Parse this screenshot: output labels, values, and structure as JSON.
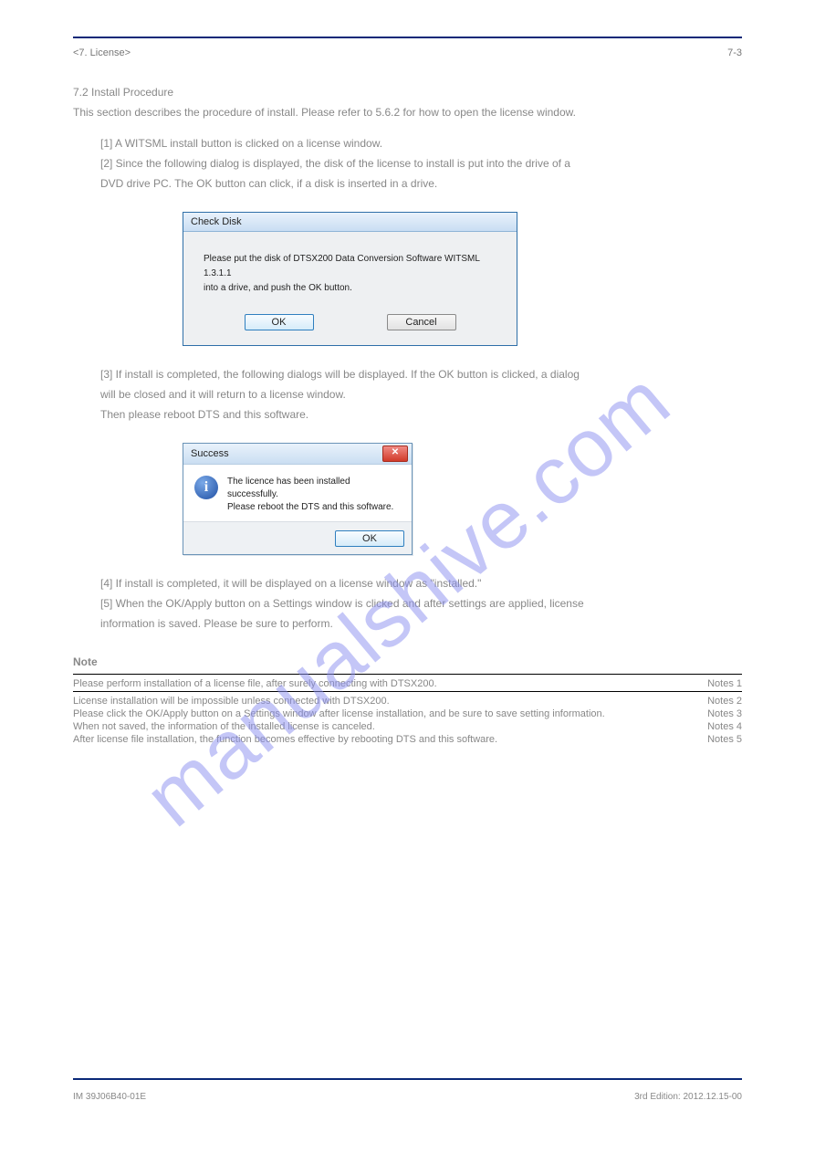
{
  "header": {
    "doc_ref": "<7. License>",
    "page_num": "7-3"
  },
  "intro": {
    "line1": "7.2  Install Procedure",
    "line2": "This section describes the procedure of install. Please refer to 5.6.2 for how to open the license window.",
    "step1": "[1] A WITSML install button is clicked on a license window.",
    "step2_a": "[2] Since the following dialog is displayed, the disk of the license to install is put into the drive of a",
    "step2_b": "DVD drive PC. The OK button can click, if a disk is inserted in a drive."
  },
  "dlg1": {
    "title": "Check Disk",
    "msg1": "Please put the disk of DTSX200 Data Conversion Software WITSML 1.3.1.1",
    "msg2": "into a drive, and push the OK button.",
    "ok": "OK",
    "cancel": "Cancel"
  },
  "between": {
    "step3_a": "[3] If install is completed, the following dialogs will be displayed. If the OK button is clicked, a dialog",
    "step3_b": "will be closed and it will return to a license window.",
    "step3_c": "Then please reboot DTS and this software."
  },
  "dlg2": {
    "title": "Success",
    "msg1": "The licence has been installed successfully.",
    "msg2": "Please reboot the DTS and this software.",
    "ok": "OK"
  },
  "after": {
    "step4": "[4] If install is completed, it will be displayed on a license window as \"installed.\"",
    "step5_a": "[5] When the OK/Apply button on a Settings window is clicked and after settings are applied, license",
    "step5_b": "information is saved. Please be sure to perform."
  },
  "notes": {
    "heading": "Note",
    "n1_left": "Please perform installation of a license file, after surely connecting with DTSX200.",
    "n1_right": "Notes 1",
    "n2_left": "License installation will be impossible unless connected with DTSX200.",
    "n2_right": "Notes 2",
    "n3_left": "Please click the OK/Apply button on a Settings window after license installation, and be sure to save setting information.",
    "n3_right": "Notes 3",
    "n4_left": "When not saved, the information of the installed license is canceled.",
    "n4_right": "Notes 4",
    "n5_left": "After license file installation, the function becomes effective by rebooting DTS and this software.",
    "n5_right": "Notes 5"
  },
  "footer": {
    "left": "IM 39J06B40-01E",
    "right": "3rd Edition: 2012.12.15-00"
  },
  "watermark": "manualshive.com"
}
